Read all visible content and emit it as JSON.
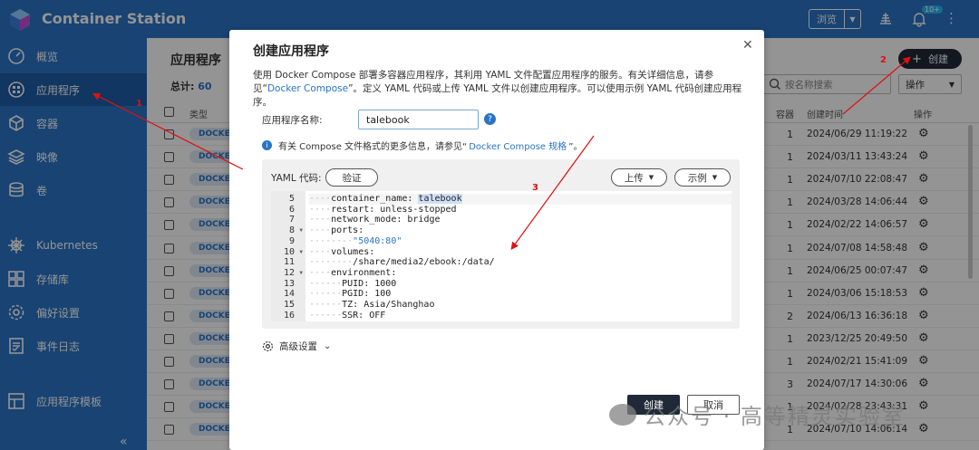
{
  "app": {
    "title": "Container Station"
  },
  "topbar": {
    "browse_label": "浏览",
    "badge": "10+"
  },
  "sidebar": {
    "items": [
      {
        "label": "概览",
        "icon": "gauge-icon"
      },
      {
        "label": "应用程序",
        "icon": "apps-icon",
        "active": true
      },
      {
        "label": "容器",
        "icon": "cube-icon"
      },
      {
        "label": "映像",
        "icon": "layers-icon"
      },
      {
        "label": "卷",
        "icon": "database-icon"
      },
      {
        "label": "Kubernetes",
        "icon": "helm-icon"
      },
      {
        "label": "存储库",
        "icon": "grid-icon"
      },
      {
        "label": "偏好设置",
        "icon": "gear-icon"
      },
      {
        "label": "事件日志",
        "icon": "log-icon"
      },
      {
        "label": "应用程序模板",
        "icon": "template-icon"
      }
    ],
    "collapse_label": "«"
  },
  "main": {
    "title": "应用程序",
    "total_label": "总计:",
    "total_value": "60",
    "create_label": "创建",
    "search_placeholder": "按名称搜索",
    "operations_label": "操作",
    "columns": {
      "type": "类型",
      "containers": "容器",
      "created": "创建时间",
      "action": "操作"
    },
    "rows": [
      {
        "type": "DOCKER",
        "count": "1",
        "created": "2024/06/29 11:19:22"
      },
      {
        "type": "DOCKER",
        "count": "1",
        "created": "2024/03/11 13:43:24"
      },
      {
        "type": "DOCKER",
        "count": "1",
        "created": "2024/07/10 22:08:47"
      },
      {
        "type": "DOCKER",
        "count": "1",
        "created": "2024/03/28 14:06:44"
      },
      {
        "type": "DOCKER",
        "count": "1",
        "created": "2024/02/22 14:06:57"
      },
      {
        "type": "DOCKER",
        "count": "1",
        "created": "2024/07/08 14:58:48"
      },
      {
        "type": "DOCKER",
        "count": "1",
        "created": "2024/06/25 00:07:47"
      },
      {
        "type": "DOCKER",
        "count": "1",
        "created": "2024/03/06 15:18:53"
      },
      {
        "type": "DOCKER",
        "count": "2",
        "created": "2024/06/13 16:36:18"
      },
      {
        "type": "DOCKER",
        "count": "1",
        "created": "2023/12/25 20:49:50"
      },
      {
        "type": "DOCKER",
        "count": "1",
        "created": "2024/02/21 15:41:09"
      },
      {
        "type": "DOCKER",
        "count": "3",
        "created": "2024/07/17 14:30:06"
      },
      {
        "type": "DOCKER",
        "count": "1",
        "created": "2024/02/28 23:43:31"
      },
      {
        "type": "DOCKER",
        "count": "1",
        "created": "2024/07/10 14:06:14"
      }
    ]
  },
  "modal": {
    "title": "创建应用程序",
    "desc_1": "使用 Docker Compose 部署多容器应用程序，其利用 YAML 文件配置应用程序的服务。有关详细信息，请参见“",
    "desc_link": "Docker Compose",
    "desc_2": "”。定义 YAML 代码或上传 YAML 文件以创建应用程序。可以使用示例 YAML 代码创建应用程序。",
    "name_label": "应用程序名称:",
    "name_value": "talebook",
    "info_1": "有关 Compose 文件格式的更多信息，请参见“",
    "info_link": "Docker Compose 规格",
    "info_2": "”。",
    "yaml_label": "YAML 代码:",
    "validate_label": "验证",
    "upload_label": "上传",
    "sample_label": "示例",
    "advanced_label": "高级设置",
    "create_label": "创建",
    "cancel_label": "取消",
    "code_lines": [
      {
        "n": "5",
        "indent": "····",
        "text": "container_name: ",
        "val": "talebook",
        "fold": false
      },
      {
        "n": "6",
        "indent": "····",
        "text": "restart: unless-stopped",
        "val": "",
        "fold": false
      },
      {
        "n": "7",
        "indent": "····",
        "text": "network_mode: bridge",
        "val": "",
        "fold": false
      },
      {
        "n": "8",
        "indent": "····",
        "text": "ports:",
        "val": "",
        "fold": true
      },
      {
        "n": "9",
        "indent": "······-·",
        "text": "",
        "val": "\"5040:80\"",
        "fold": false
      },
      {
        "n": "10",
        "indent": "····",
        "text": "volumes:",
        "val": "",
        "fold": true
      },
      {
        "n": "11",
        "indent": "······-·",
        "text": "/share/media2/ebook:/data/",
        "val": "",
        "fold": false
      },
      {
        "n": "12",
        "indent": "····",
        "text": "environment:",
        "val": "",
        "fold": true
      },
      {
        "n": "13",
        "indent": "······",
        "text": "PUID: 1000",
        "val": "",
        "fold": false
      },
      {
        "n": "14",
        "indent": "······",
        "text": "PGID: 100",
        "val": "",
        "fold": false
      },
      {
        "n": "15",
        "indent": "······",
        "text": "TZ: Asia/Shanghao",
        "val": "",
        "fold": false
      },
      {
        "n": "16",
        "indent": "······",
        "text": "SSR: OFF",
        "val": "",
        "fold": false
      }
    ]
  },
  "annotations": {
    "n1": "1",
    "n2": "2",
    "n3": "3"
  },
  "watermark": "公众号 · 高等精灵实验室",
  "colors": {
    "brand": "#2a74c6",
    "dark_button": "#1f2937",
    "annotation": "#d11111"
  }
}
